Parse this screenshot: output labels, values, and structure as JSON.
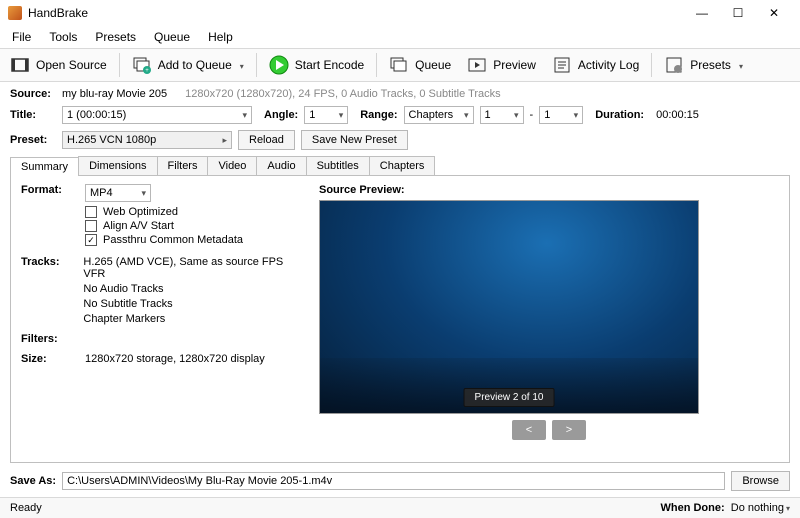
{
  "window": {
    "title": "HandBrake"
  },
  "menu": [
    "File",
    "Tools",
    "Presets",
    "Queue",
    "Help"
  ],
  "toolbar": {
    "open": "Open Source",
    "addq": "Add to Queue",
    "start": "Start Encode",
    "queue": "Queue",
    "preview": "Preview",
    "log": "Activity Log",
    "presets": "Presets"
  },
  "source": {
    "label": "Source:",
    "name": "my blu-ray Movie 205",
    "info": "1280x720 (1280x720), 24 FPS, 0 Audio Tracks, 0 Subtitle Tracks"
  },
  "title": {
    "label": "Title:",
    "value": "1 (00:00:15)"
  },
  "angle": {
    "label": "Angle:",
    "value": "1"
  },
  "range": {
    "label": "Range:",
    "mode": "Chapters",
    "from": "1",
    "to": "1",
    "dash": "-"
  },
  "duration": {
    "label": "Duration:",
    "value": "00:00:15"
  },
  "preset": {
    "label": "Preset:",
    "value": "H.265 VCN 1080p",
    "reload": "Reload",
    "save": "Save New Preset"
  },
  "tabs": [
    "Summary",
    "Dimensions",
    "Filters",
    "Video",
    "Audio",
    "Subtitles",
    "Chapters"
  ],
  "summary": {
    "format_label": "Format:",
    "format_value": "MP4",
    "web_opt": "Web Optimized",
    "align": "Align A/V Start",
    "passthru": "Passthru Common Metadata",
    "tracks_label": "Tracks:",
    "tracks": [
      "H.265 (AMD VCE), Same as source FPS VFR",
      "No Audio Tracks",
      "No Subtitle Tracks",
      "Chapter Markers"
    ],
    "filters_label": "Filters:",
    "size_label": "Size:",
    "size_value": "1280x720 storage, 1280x720 display"
  },
  "preview": {
    "label": "Source Preview:",
    "badge": "Preview 2 of 10",
    "prev": "<",
    "next": ">"
  },
  "saveas": {
    "label": "Save As:",
    "path": "C:\\Users\\ADMIN\\Videos\\My Blu-Ray Movie 205-1.m4v",
    "browse": "Browse"
  },
  "status": {
    "ready": "Ready",
    "when_done_label": "When Done:",
    "when_done": "Do nothing"
  }
}
